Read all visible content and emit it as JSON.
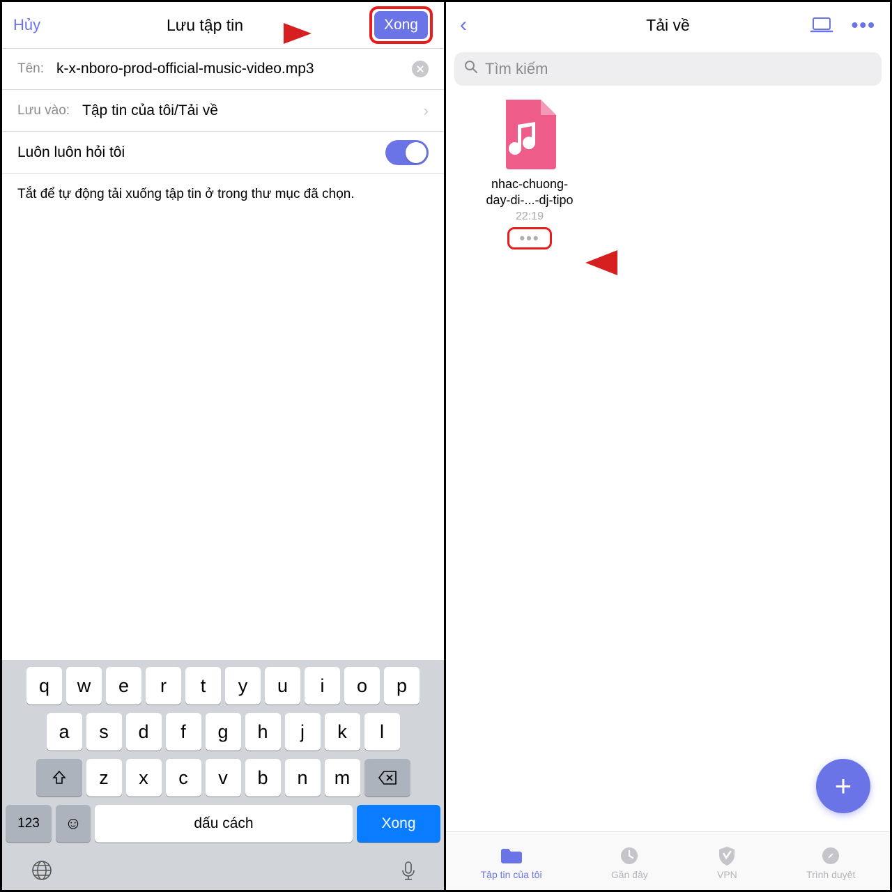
{
  "left": {
    "cancel": "Hủy",
    "title": "Lưu tập tin",
    "done": "Xong",
    "name_label": "Tên:",
    "name_value": "k-x-nboro-prod-official-music-video.mp3",
    "save_label": "Lưu vào:",
    "save_value": "Tập tin của tôi/Tải về",
    "ask_label": "Luôn luôn hỏi tôi",
    "help": "Tắt để tự động tải xuống tập tin ở trong thư mục đã chọn.",
    "kbd": {
      "r1": [
        "q",
        "w",
        "e",
        "r",
        "t",
        "y",
        "u",
        "i",
        "o",
        "p"
      ],
      "r2": [
        "a",
        "s",
        "d",
        "f",
        "g",
        "h",
        "j",
        "k",
        "l"
      ],
      "r3": [
        "z",
        "x",
        "c",
        "v",
        "b",
        "n",
        "m"
      ],
      "num": "123",
      "space": "dấu cách",
      "done": "Xong"
    }
  },
  "right": {
    "title": "Tải về",
    "search_ph": "Tìm kiếm",
    "file": {
      "name1": "nhac-chuong-",
      "name2": "day-di-...-dj-tipo",
      "time": "22:19"
    },
    "tabs": {
      "files": "Tập tin của tôi",
      "recent": "Gần đây",
      "vpn": "VPN",
      "browser": "Trình duyệt"
    }
  }
}
